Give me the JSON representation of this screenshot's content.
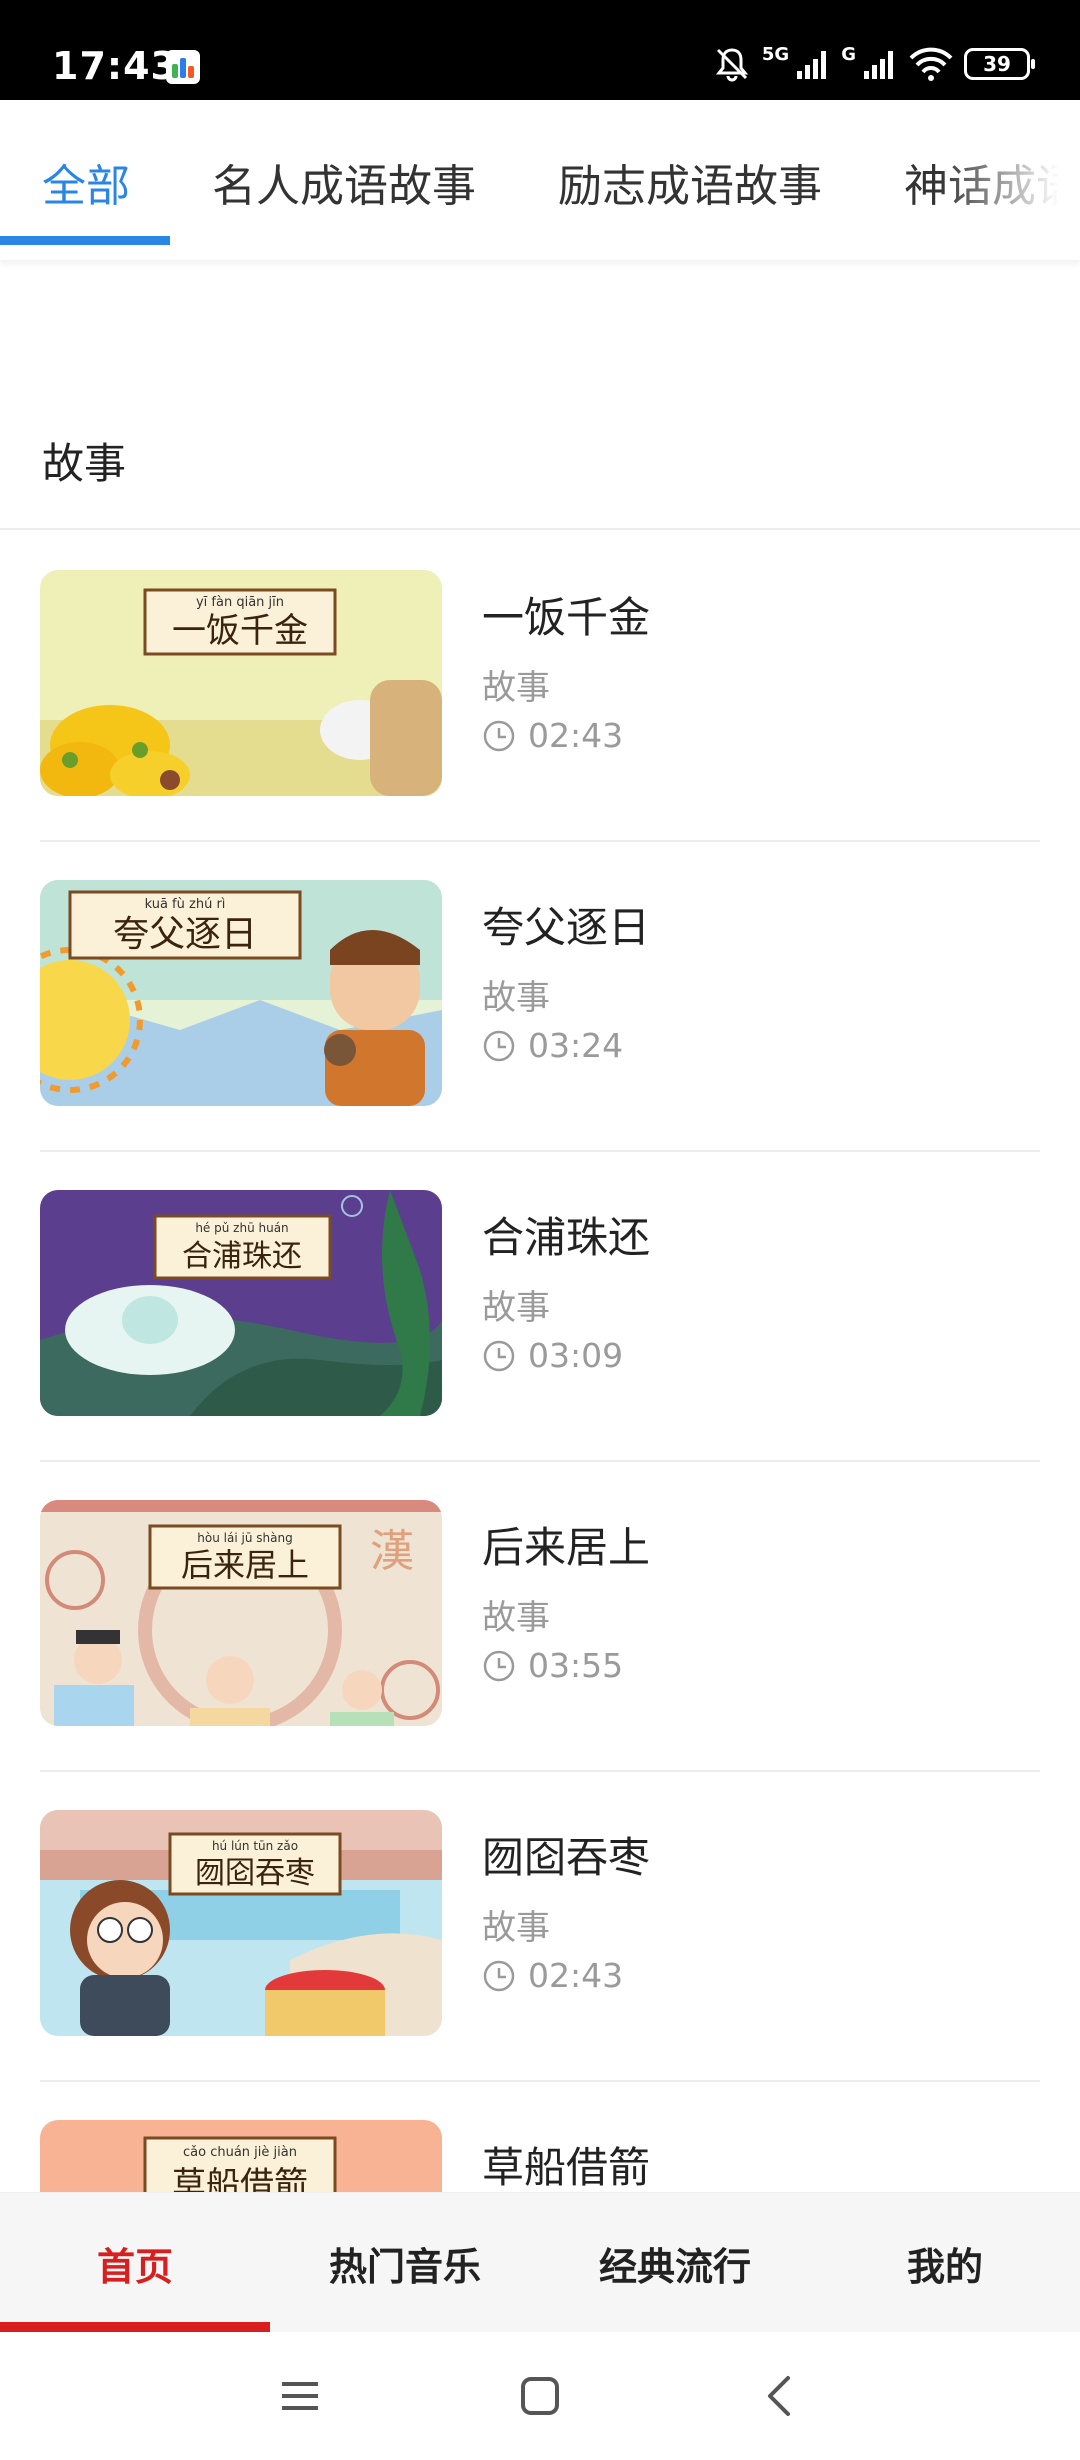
{
  "status_bar": {
    "time": "17:43",
    "network_label_1": "5G",
    "network_label_2": "G",
    "battery": "39",
    "icons": [
      "app-notification-icon",
      "mute-bell-icon",
      "signal-icon",
      "wifi-icon",
      "battery-icon"
    ]
  },
  "tabs": [
    {
      "label": "全部",
      "active": true
    },
    {
      "label": "名人成语故事",
      "active": false
    },
    {
      "label": "励志成语故事",
      "active": false
    },
    {
      "label": "神话成语",
      "active": false
    }
  ],
  "section": {
    "title": "故事"
  },
  "items": [
    {
      "title": "一饭千金",
      "category": "故事",
      "duration": "02:43",
      "thumb_caption": "一饭千金",
      "thumb_pinyin": "yī fàn qiān jīn"
    },
    {
      "title": "夸父逐日",
      "category": "故事",
      "duration": "03:24",
      "thumb_caption": "夸父逐日",
      "thumb_pinyin": "kuā fù zhú rì"
    },
    {
      "title": "合浦珠还",
      "category": "故事",
      "duration": "03:09",
      "thumb_caption": "合浦珠还",
      "thumb_pinyin": "hé pǔ zhū huán"
    },
    {
      "title": "后来居上",
      "category": "故事",
      "duration": "03:55",
      "thumb_caption": "后来居上",
      "thumb_pinyin": "hòu lái jū shàng"
    },
    {
      "title": "囫囵吞枣",
      "category": "故事",
      "duration": "02:43",
      "thumb_caption": "囫囵吞枣",
      "thumb_pinyin": "hú lún tūn zǎo"
    },
    {
      "title": "草船借箭",
      "category": "",
      "duration": "",
      "thumb_caption": "草船借箭",
      "thumb_pinyin": "cǎo chuán jiè jiàn"
    }
  ],
  "bottom_nav": [
    {
      "label": "首页",
      "active": true
    },
    {
      "label": "热门音乐",
      "active": false
    },
    {
      "label": "经典流行",
      "active": false
    },
    {
      "label": "我的",
      "active": false
    }
  ],
  "colors": {
    "tab_accent": "#2a86e6",
    "nav_accent": "#d81e1e"
  }
}
